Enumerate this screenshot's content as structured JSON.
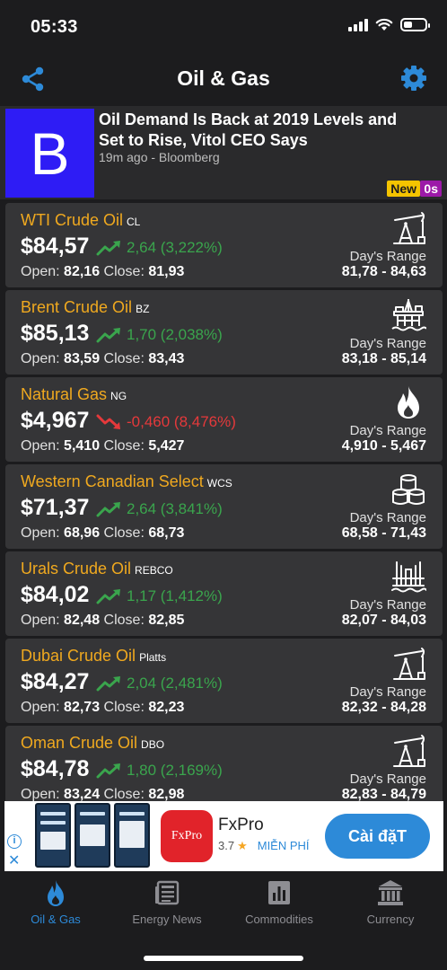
{
  "status_bar": {
    "time": "05:33"
  },
  "nav": {
    "title": "Oil & Gas"
  },
  "news": {
    "logo_letter": "B",
    "title": "Oil Demand Is Back at 2019 Levels and Set to Rise, Vitol CEO Says",
    "meta": "19m ago - Bloomberg",
    "badge_new": "New",
    "badge_age": "0s"
  },
  "labels": {
    "open": "Open:",
    "close": "Close:",
    "days_range": "Day's Range"
  },
  "quotes": [
    {
      "name": "WTI Crude Oil",
      "code": "CL",
      "price": "$84,57",
      "change": "2,64 (3,222%)",
      "direction": "up",
      "open": "82,16",
      "close": "81,93",
      "range": "81,78 - 84,63",
      "icon": "pumpjack-icon"
    },
    {
      "name": "Brent Crude Oil",
      "code": "BZ",
      "price": "$85,13",
      "change": "1,70 (2,038%)",
      "direction": "up",
      "open": "83,59",
      "close": "83,43",
      "range": "83,18 - 85,14",
      "icon": "offshore-rig-icon"
    },
    {
      "name": "Natural Gas",
      "code": "NG",
      "price": "$4,967",
      "change": "-0,460 (8,476%)",
      "direction": "down",
      "open": "5,410",
      "close": "5,427",
      "range": "4,910 - 5,467",
      "icon": "flame-icon"
    },
    {
      "name": "Western Canadian Select",
      "code": "WCS",
      "price": "$71,37",
      "change": "2,64 (3,841%)",
      "direction": "up",
      "open": "68,96",
      "close": "68,73",
      "range": "68,58 - 71,43",
      "icon": "barrels-icon"
    },
    {
      "name": "Urals Crude Oil",
      "code": "REBCO",
      "price": "$84,02",
      "change": "1,17 (1,412%)",
      "direction": "up",
      "open": "82,48",
      "close": "82,85",
      "range": "82,07 - 84,03",
      "icon": "refinery-icon"
    },
    {
      "name": "Dubai Crude Oil",
      "code": "Platts",
      "price": "$84,27",
      "change": "2,04 (2,481%)",
      "direction": "up",
      "open": "82,73",
      "close": "82,23",
      "range": "82,32 - 84,28",
      "icon": "pumpjack-icon"
    },
    {
      "name": "Oman Crude Oil",
      "code": "DBO",
      "price": "$84,78",
      "change": "1,80 (2,169%)",
      "direction": "up",
      "open": "83,24",
      "close": "82,98",
      "range": "82,83 - 84,79",
      "icon": "pumpjack-icon"
    }
  ],
  "ad": {
    "logo_text": "FxPro",
    "name": "FxPro",
    "rating": "3.7",
    "price": "MIỄN PHÍ",
    "cta": "Cài đặT"
  },
  "tabs": [
    {
      "label": "Oil & Gas",
      "icon": "flame-icon",
      "active": true
    },
    {
      "label": "Energy News",
      "icon": "newspaper-icon",
      "active": false
    },
    {
      "label": "Commodities",
      "icon": "bar-chart-icon",
      "active": false
    },
    {
      "label": "Currency",
      "icon": "bank-icon",
      "active": false
    }
  ],
  "colors": {
    "accent": "#2d8ad8",
    "name": "#f0a91f",
    "up": "#3aa54d",
    "down": "#e5393b",
    "card": "#353537",
    "background": "#1c1c1e"
  }
}
